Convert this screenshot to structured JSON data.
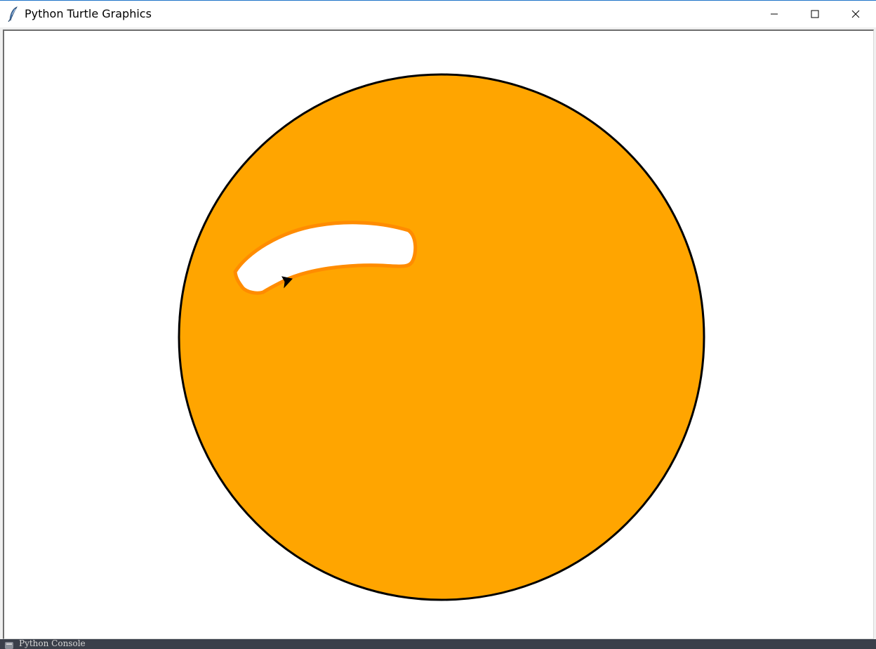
{
  "window": {
    "title": "Python Turtle Graphics",
    "icon": "feather-icon",
    "controls": {
      "minimize_icon": "minimize-icon",
      "maximize_icon": "maximize-icon",
      "close_icon": "close-icon"
    }
  },
  "canvas": {
    "background": "#ffffff",
    "shapes": [
      {
        "kind": "circle",
        "fill": "#ffa500",
        "stroke": "#000000"
      },
      {
        "kind": "highlight-blob",
        "fill": "#ffffff",
        "stroke": "#ff8c00"
      }
    ],
    "turtle_icon": "turtle-arrow-icon"
  },
  "taskbar": {
    "label": "Python Console",
    "icon": "python-icon",
    "background": "#3a3f4a"
  }
}
